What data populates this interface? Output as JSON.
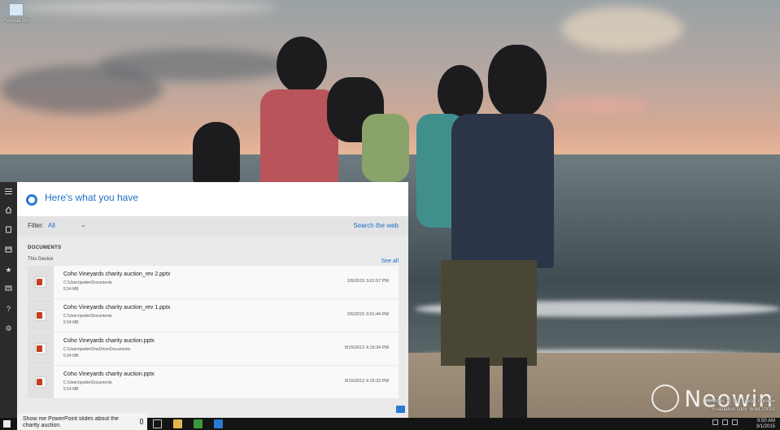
{
  "desktop": {
    "icon_label": "Recycle Bin",
    "watermark_line1": "Windows 10 Pro Insider Preview",
    "watermark_line2": "Evaluation copy. Build 10051",
    "brand": "Neowin"
  },
  "cortana": {
    "title": "Here's what you have",
    "filter_label": "Filter:",
    "filter_value": "All",
    "search_web": "Search the web",
    "section_title": "DOCUMENTS",
    "section_sub": "This Device",
    "see_all": "See all",
    "documents": [
      {
        "name": "Coho Vineyards charity auction_rev 2.pptx",
        "path": "C:\\Users\\joebe\\Documents",
        "size": "5.54 MB",
        "date": "2/6/2015 3:01:57 PM"
      },
      {
        "name": "Coho Vineyards charity auction_rev 1.pptx",
        "path": "C:\\Users\\joebe\\Documents",
        "size": "5.54 MB",
        "date": "2/6/2015 3:01:44 PM"
      },
      {
        "name": "Coho Vineyards charity auction.pptx",
        "path": "C:\\Users\\joebe\\OneDrive\\Documents",
        "size": "5.54 MB",
        "date": "8/15/2012 4:19:34 PM"
      },
      {
        "name": "Coho Vineyards charity auction.pptx",
        "path": "C:\\Users\\joebe\\Documents",
        "size": "5.54 MB",
        "date": "8/15/2012 4:19:33 PM"
      }
    ],
    "rail_icons": [
      "hamburger-icon",
      "home-icon",
      "notebook-icon",
      "reminders-icon",
      "favorites-icon",
      "news-icon",
      "help-icon",
      "settings-icon"
    ]
  },
  "searchbox": {
    "query": "Show me PowerPoint slides about the charity auction."
  },
  "taskbar": {
    "time": "9:50 AM",
    "date": "3/1/2015"
  },
  "colors": {
    "accent": "#2b7ad0",
    "rail": "#2b2b2b",
    "taskbar": "#141414",
    "ppt_red": "#c43e1c"
  }
}
